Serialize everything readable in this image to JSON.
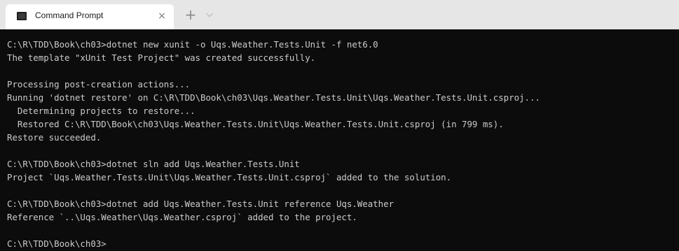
{
  "tab": {
    "icon": "command-prompt-icon",
    "title": "Command Prompt",
    "close_glyph": "×",
    "new_tab_glyph": "+",
    "dropdown_glyph": "⌵"
  },
  "terminal": {
    "lines": [
      "C:\\R\\TDD\\Book\\ch03>dotnet new xunit -o Uqs.Weather.Tests.Unit -f net6.0",
      "The template \"xUnit Test Project\" was created successfully.",
      "",
      "Processing post-creation actions...",
      "Running 'dotnet restore' on C:\\R\\TDD\\Book\\ch03\\Uqs.Weather.Tests.Unit\\Uqs.Weather.Tests.Unit.csproj...",
      "  Determining projects to restore...",
      "  Restored C:\\R\\TDD\\Book\\ch03\\Uqs.Weather.Tests.Unit\\Uqs.Weather.Tests.Unit.csproj (in 799 ms).",
      "Restore succeeded.",
      "",
      "C:\\R\\TDD\\Book\\ch03>dotnet sln add Uqs.Weather.Tests.Unit",
      "Project `Uqs.Weather.Tests.Unit\\Uqs.Weather.Tests.Unit.csproj` added to the solution.",
      "",
      "C:\\R\\TDD\\Book\\ch03>dotnet add Uqs.Weather.Tests.Unit reference Uqs.Weather",
      "Reference `..\\Uqs.Weather\\Uqs.Weather.csproj` added to the project.",
      "",
      "C:\\R\\TDD\\Book\\ch03>"
    ]
  },
  "colors": {
    "terminal_background": "#0c0c0c",
    "terminal_text": "#cccccc",
    "tabbar_background": "#e6e6e6",
    "active_tab_background": "#ffffff"
  }
}
